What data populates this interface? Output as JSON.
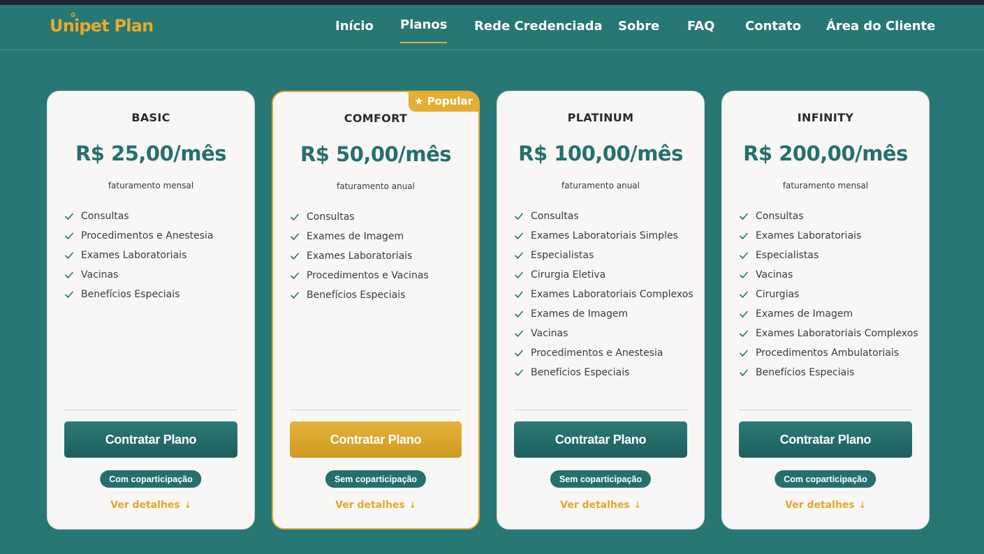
{
  "brand": {
    "name": "Unipet Plan"
  },
  "nav": {
    "items": [
      {
        "label": "Início"
      },
      {
        "label": "Planos"
      },
      {
        "label": "Rede Credenciada"
      },
      {
        "label": "Sobre"
      },
      {
        "label": "FAQ"
      },
      {
        "label": "Contato"
      },
      {
        "label": "Área do Cliente"
      }
    ],
    "active": "Planos"
  },
  "colors": {
    "teal": "#277775",
    "gold": "#e0a82a",
    "card": "#f8f7f5"
  },
  "plans": [
    {
      "name": "BASIC",
      "price": "R$ 25,00/mês",
      "billing": "faturamento mensal",
      "features": [
        "Consultas",
        "Procedimentos e Anestesia",
        "Exames Laboratoriais",
        "Vacinas",
        "Benefícios Especiais"
      ],
      "cta": "Contratar Plano",
      "badge": "Com coparticipação",
      "details": "Ver detalhes"
    },
    {
      "name": "COMFORT",
      "price": "R$ 50,00/mês",
      "billing": "faturamento anual",
      "popular": "Popular",
      "features": [
        "Consultas",
        "Exames de Imagem",
        "Exames Laboratoriais",
        "Procedimentos e Vacinas",
        "Benefícios Especiais"
      ],
      "cta": "Contratar Plano",
      "badge": "Sem coparticipação",
      "details": "Ver detalhes"
    },
    {
      "name": "PLATINUM",
      "price": "R$ 100,00/mês",
      "billing": "faturamento anual",
      "features": [
        "Consultas",
        "Exames Laboratoriais Simples",
        "Especialistas",
        "Cirurgia Eletiva",
        "Exames Laboratoriais Complexos",
        "Exames de Imagem",
        "Vacinas",
        "Procedimentos e Anestesia",
        "Benefícios Especiais"
      ],
      "cta": "Contratar Plano",
      "badge": "Sem coparticipação",
      "details": "Ver detalhes"
    },
    {
      "name": "INFINITY",
      "price": "R$ 200,00/mês",
      "billing": "faturamento mensal",
      "features": [
        "Consultas",
        "Exames Laboratoriais",
        "Especialistas",
        "Vacinas",
        "Cirurgias",
        "Exames de Imagem",
        "Exames Laboratoriais Complexos",
        "Procedimentos Ambulatoriais",
        "Benefícios Especiais"
      ],
      "cta": "Contratar Plano",
      "badge": "Com coparticipação",
      "details": "Ver detalhes"
    }
  ]
}
